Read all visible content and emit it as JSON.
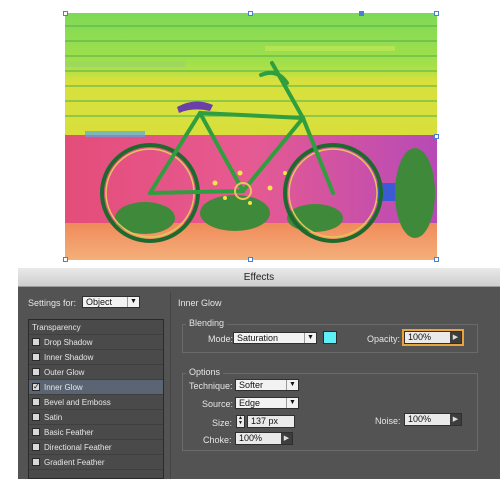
{
  "dialog": {
    "title": "Effects",
    "settings_for_label": "Settings for:",
    "settings_for_value": "Object",
    "effect_title": "Inner Glow"
  },
  "effects_list": [
    {
      "label": "Transparency",
      "checkbox": false,
      "checked": false,
      "selected": false
    },
    {
      "label": "Drop Shadow",
      "checkbox": true,
      "checked": false,
      "selected": false
    },
    {
      "label": "Inner Shadow",
      "checkbox": true,
      "checked": false,
      "selected": false
    },
    {
      "label": "Outer Glow",
      "checkbox": true,
      "checked": false,
      "selected": false
    },
    {
      "label": "Inner Glow",
      "checkbox": true,
      "checked": true,
      "selected": true
    },
    {
      "label": "Bevel and Emboss",
      "checkbox": true,
      "checked": false,
      "selected": false
    },
    {
      "label": "Satin",
      "checkbox": true,
      "checked": false,
      "selected": false
    },
    {
      "label": "Basic Feather",
      "checkbox": true,
      "checked": false,
      "selected": false
    },
    {
      "label": "Directional Feather",
      "checkbox": true,
      "checked": false,
      "selected": false
    },
    {
      "label": "Gradient Feather",
      "checkbox": true,
      "checked": false,
      "selected": false
    }
  ],
  "blending": {
    "heading": "Blending",
    "mode_label": "Mode:",
    "mode_value": "Saturation",
    "swatch_color": "#5ff0f6",
    "opacity_label": "Opacity:",
    "opacity_value": "100%"
  },
  "options": {
    "heading": "Options",
    "technique_label": "Technique:",
    "technique_value": "Softer",
    "source_label": "Source:",
    "source_value": "Edge",
    "size_label": "Size:",
    "size_value": "137 px",
    "noise_label": "Noise:",
    "noise_value": "100%",
    "choke_label": "Choke:",
    "choke_value": "100%"
  },
  "icons": {
    "dropdown": "chevron-down-icon",
    "stepper": "stepper-icon",
    "slider_arrow": "triangle-right-icon",
    "check": "checkmark-icon"
  },
  "colors": {
    "dialog_bg": "#535353",
    "selection": "#5a6472",
    "focus_ring": "#e8a33a"
  }
}
